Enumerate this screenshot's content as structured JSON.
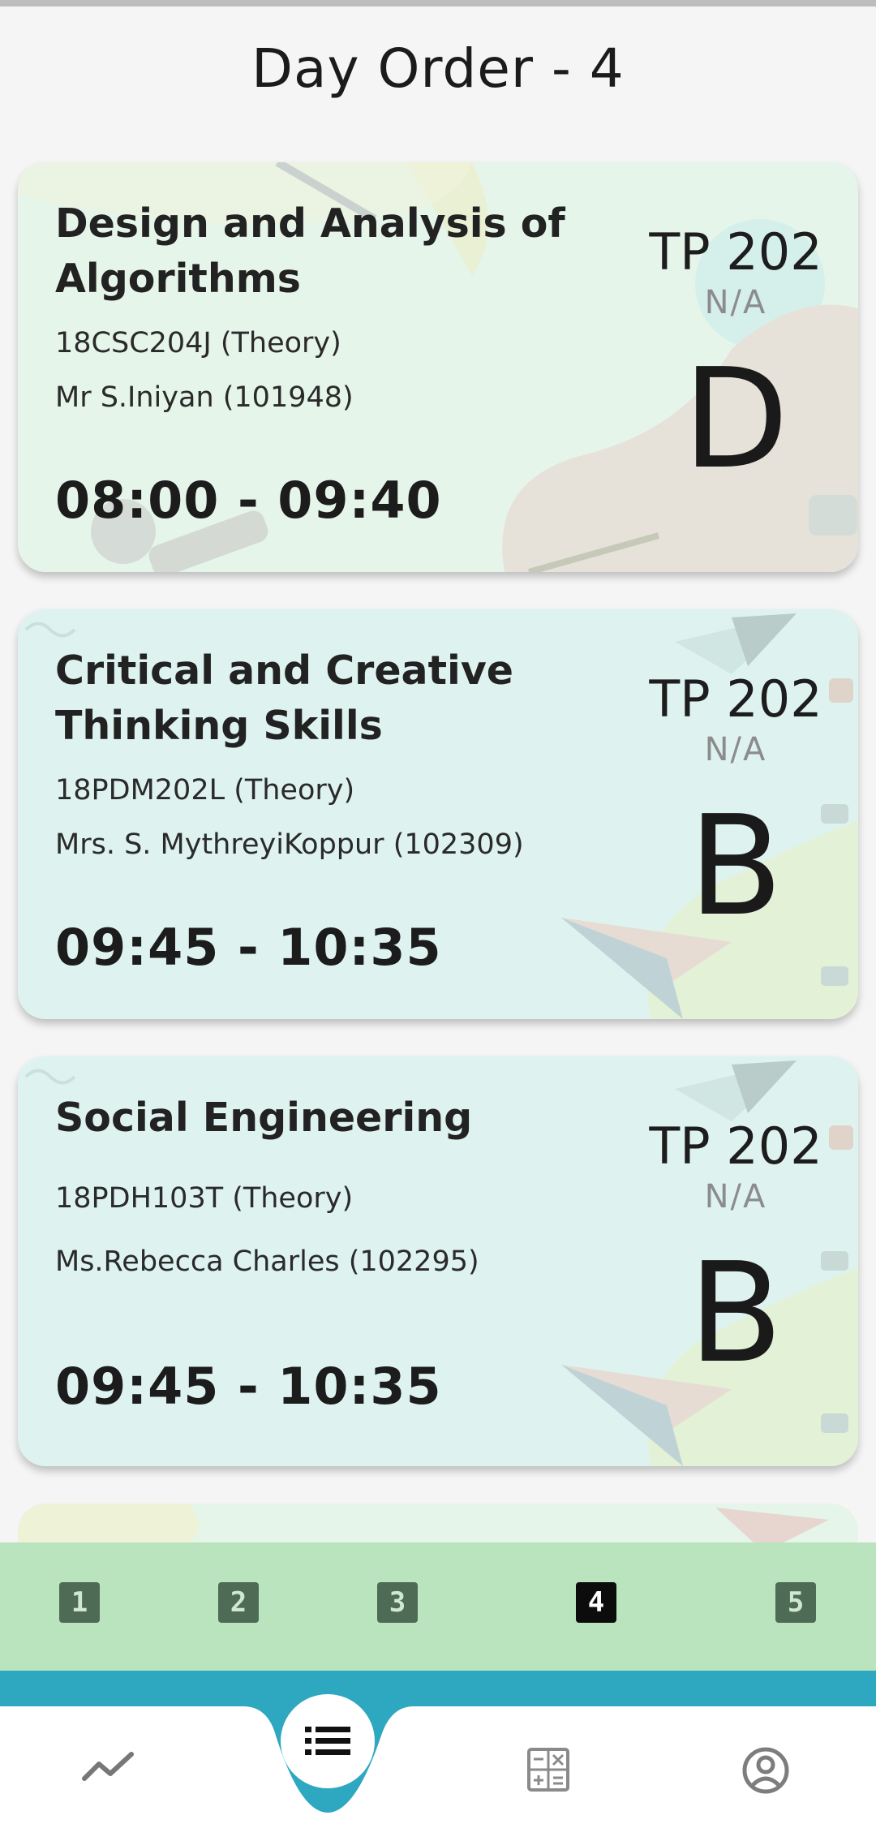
{
  "header": {
    "title": "Day Order - 4"
  },
  "classes": [
    {
      "title_line1": "Design and Analysis of",
      "title_line2": "Algorithms",
      "code": "18CSC204J (Theory)",
      "faculty": "Mr S.Iniyan (101948)",
      "time": "08:00 - 09:40",
      "room": "TP 202",
      "room_sub": "N/A",
      "slot": "D"
    },
    {
      "title_line1": "Critical and Creative",
      "title_line2": "Thinking Skills",
      "code": "18PDM202L (Theory)",
      "faculty": "Mrs. S. MythreyiKoppur (102309)",
      "time": "09:45 - 10:35",
      "room": "TP 202",
      "room_sub": "N/A",
      "slot": "B"
    },
    {
      "title_line1": "Social Engineering",
      "title_line2": "",
      "code": "18PDH103T (Theory)",
      "faculty": "Ms.Rebecca Charles (102295)",
      "time": "09:45 - 10:35",
      "room": "TP 202",
      "room_sub": "N/A",
      "slot": "B"
    }
  ],
  "day_selector": {
    "days": [
      "1",
      "2",
      "3",
      "4",
      "5"
    ],
    "active": "4"
  },
  "bottom_nav": {
    "items": [
      "stats-icon",
      "list-icon",
      "calculator-icon",
      "profile-icon"
    ],
    "active": "list-icon"
  },
  "colors": {
    "accent": "#2ea7c1",
    "day_bar": "#b9e4bd",
    "day_chip": "#4e6b55",
    "day_chip_active": "#0c0c0c"
  }
}
